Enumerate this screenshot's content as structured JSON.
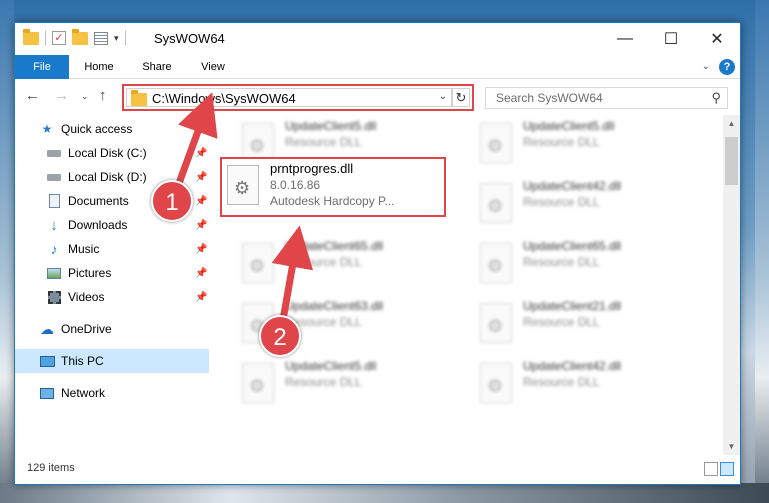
{
  "window": {
    "title": "SysWOW64",
    "controls": {
      "minimize": "—",
      "maximize": "☐",
      "close": "✕"
    }
  },
  "ribbon": {
    "tabs": [
      "File",
      "Home",
      "Share",
      "View"
    ],
    "help": "?"
  },
  "address_bar": {
    "path": "C:\\Windows\\SysWOW64",
    "refresh_glyph": "↻"
  },
  "search": {
    "placeholder": "Search SysWOW64",
    "icon": "search-icon"
  },
  "nav_pane": {
    "items": [
      {
        "label": "Quick access",
        "icon": "star-icon"
      },
      {
        "label": "Local Disk (C:)",
        "icon": "drive-icon"
      },
      {
        "label": "Local Disk (D:)",
        "icon": "drive-icon"
      },
      {
        "label": "Documents",
        "icon": "documents-icon"
      },
      {
        "label": "Downloads",
        "icon": "download-icon"
      },
      {
        "label": "Music",
        "icon": "music-icon"
      },
      {
        "label": "Pictures",
        "icon": "pictures-icon"
      },
      {
        "label": "Videos",
        "icon": "videos-icon"
      },
      {
        "label": "OneDrive",
        "icon": "cloud-icon"
      },
      {
        "label": "This PC",
        "icon": "computer-icon"
      },
      {
        "label": "Network",
        "icon": "network-icon"
      }
    ],
    "selected": "This PC"
  },
  "files": [
    {
      "name": "UpdateClient5.dll",
      "type": "Resource DLL"
    },
    {
      "name": "UpdateClient5.dll",
      "type": "Resource DLL"
    },
    {
      "name": "UpdateClient42.dll",
      "type": "Resource DLL"
    },
    {
      "name": "UpdateClient65.dll",
      "type": "Resource DLL"
    },
    {
      "name": "UpdateClient65.dll",
      "type": "Resource DLL"
    },
    {
      "name": "UpdateClient63.dll",
      "type": "Resource DLL"
    },
    {
      "name": "UpdateClient21.dll",
      "type": "Resource DLL"
    },
    {
      "name": "UpdateClient5.dll",
      "type": "Resource DLL"
    },
    {
      "name": "UpdateClient42.dll",
      "type": "Resource DLL"
    }
  ],
  "highlighted_file": {
    "name": "prntprogres.dll",
    "version": "8.0.16.86",
    "description": "Autodesk Hardcopy P..."
  },
  "status": {
    "item_count": "129 items"
  },
  "annotations": {
    "step1": "1",
    "step2": "2",
    "color": "#e0454a"
  }
}
